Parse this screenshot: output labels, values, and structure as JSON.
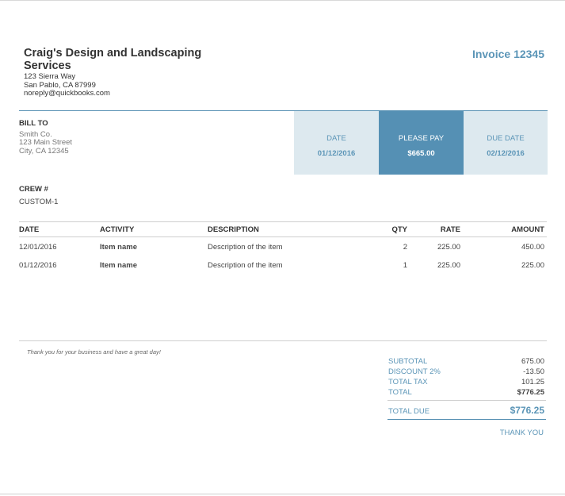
{
  "company": {
    "name": "Craig's Design and Landscaping Services",
    "address_line1": "123 Sierra Way",
    "address_line2": "San Pablo, CA 87999",
    "email": "noreply@quickbooks.com"
  },
  "invoice": {
    "title": "Invoice 12345"
  },
  "bill_to": {
    "heading": "BILL TO",
    "name": "Smith Co.",
    "street": "123 Main Street",
    "city": "City, CA 12345"
  },
  "summary": {
    "date_label": "DATE",
    "date_value": "01/12/2016",
    "pay_label": "PLEASE PAY",
    "pay_value": "$665.00",
    "due_label": "DUE DATE",
    "due_value": "02/12/2016"
  },
  "crew": {
    "label": "CREW #",
    "value": "CUSTOM-1"
  },
  "table": {
    "headers": {
      "date": "DATE",
      "activity": "ACTIVITY",
      "description": "DESCRIPTION",
      "qty": "QTY",
      "rate": "RATE",
      "amount": "AMOUNT"
    },
    "rows": [
      {
        "date": "12/01/2016",
        "activity": "Item name",
        "description": "Description of the item",
        "qty": "2",
        "rate": "225.00",
        "amount": "450.00"
      },
      {
        "date": "01/12/2016",
        "activity": "Item name",
        "description": "Description of the item",
        "qty": "1",
        "rate": "225.00",
        "amount": "225.00"
      }
    ]
  },
  "footer": {
    "note": "Thank you for your business and have a great day!"
  },
  "totals": {
    "subtotal_label": "SUBTOTAL",
    "subtotal_value": "675.00",
    "discount_label": "DISCOUNT 2%",
    "discount_value": "-13.50",
    "tax_label": "TOTAL TAX",
    "tax_value": "101.25",
    "total_label": "TOTAL",
    "total_value": "$776.25",
    "total_due_label": "TOTAL DUE",
    "total_due_value": "$776.25",
    "thank_you": "THANK YOU"
  },
  "colors": {
    "accent": "#5590b4",
    "accent_light": "#dde9ef",
    "accent_text": "#5b95b7"
  }
}
